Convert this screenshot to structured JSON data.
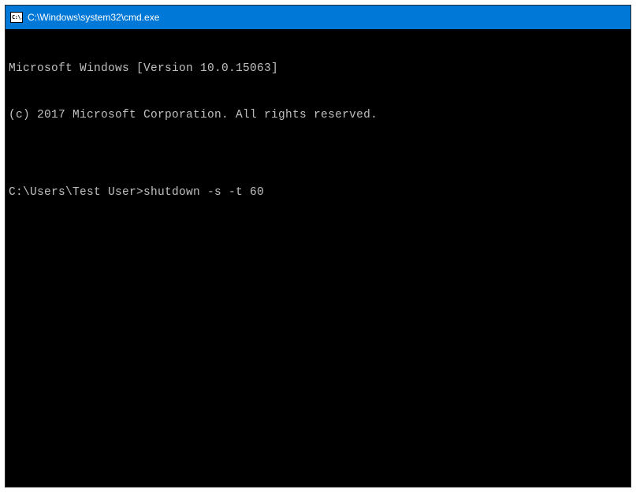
{
  "window": {
    "title": "C:\\Windows\\system32\\cmd.exe",
    "icon_label": "C:\\."
  },
  "terminal": {
    "line1": "Microsoft Windows [Version 10.0.15063]",
    "line2": "(c) 2017 Microsoft Corporation. All rights reserved.",
    "blank": "",
    "prompt": "C:\\Users\\Test User>",
    "command": "shutdown -s -t 60"
  }
}
